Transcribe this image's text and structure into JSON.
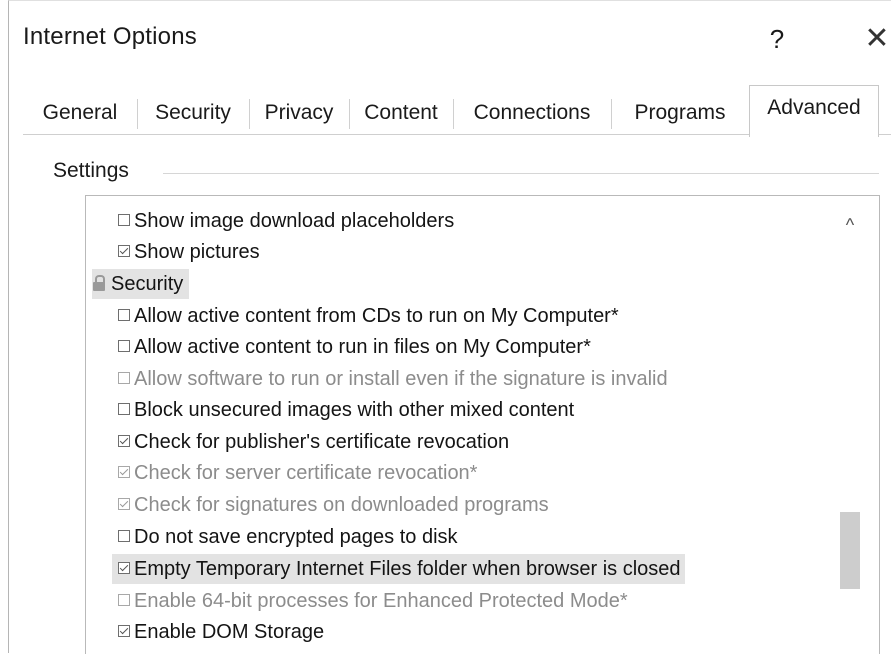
{
  "window": {
    "title": "Internet Options",
    "help_label": "?",
    "close_label": "✕"
  },
  "tabs": [
    {
      "label": "General",
      "active": false
    },
    {
      "label": "Security",
      "active": false
    },
    {
      "label": "Privacy",
      "active": false
    },
    {
      "label": "Content",
      "active": false
    },
    {
      "label": "Connections",
      "active": false
    },
    {
      "label": "Programs",
      "active": false
    },
    {
      "label": "Advanced",
      "active": true
    }
  ],
  "settings": {
    "label": "Settings",
    "items": [
      {
        "label": "Show image download placeholders",
        "checked": false,
        "disabled": false
      },
      {
        "label": "Show pictures",
        "checked": true,
        "disabled": false
      },
      {
        "label": "Security",
        "type": "category",
        "icon": "lock-icon"
      },
      {
        "label": "Allow active content from CDs to run on My Computer*",
        "checked": false,
        "disabled": false
      },
      {
        "label": "Allow active content to run in files on My Computer*",
        "checked": false,
        "disabled": false
      },
      {
        "label": "Allow software to run or install even if the signature is invalid",
        "checked": false,
        "disabled": true
      },
      {
        "label": "Block unsecured images with other mixed content",
        "checked": false,
        "disabled": false
      },
      {
        "label": "Check for publisher's certificate revocation",
        "checked": true,
        "disabled": false
      },
      {
        "label": "Check for server certificate revocation*",
        "checked": true,
        "disabled": true
      },
      {
        "label": "Check for signatures on downloaded programs",
        "checked": true,
        "disabled": true
      },
      {
        "label": "Do not save encrypted pages to disk",
        "checked": false,
        "disabled": false
      },
      {
        "label": "Empty Temporary Internet Files folder when browser is closed",
        "checked": true,
        "disabled": false,
        "highlighted": true
      },
      {
        "label": "Enable 64-bit processes for Enhanced Protected Mode*",
        "checked": false,
        "disabled": true
      },
      {
        "label": "Enable DOM Storage",
        "checked": true,
        "disabled": false
      }
    ]
  },
  "scrollbar": {
    "up_arrow": "^"
  }
}
